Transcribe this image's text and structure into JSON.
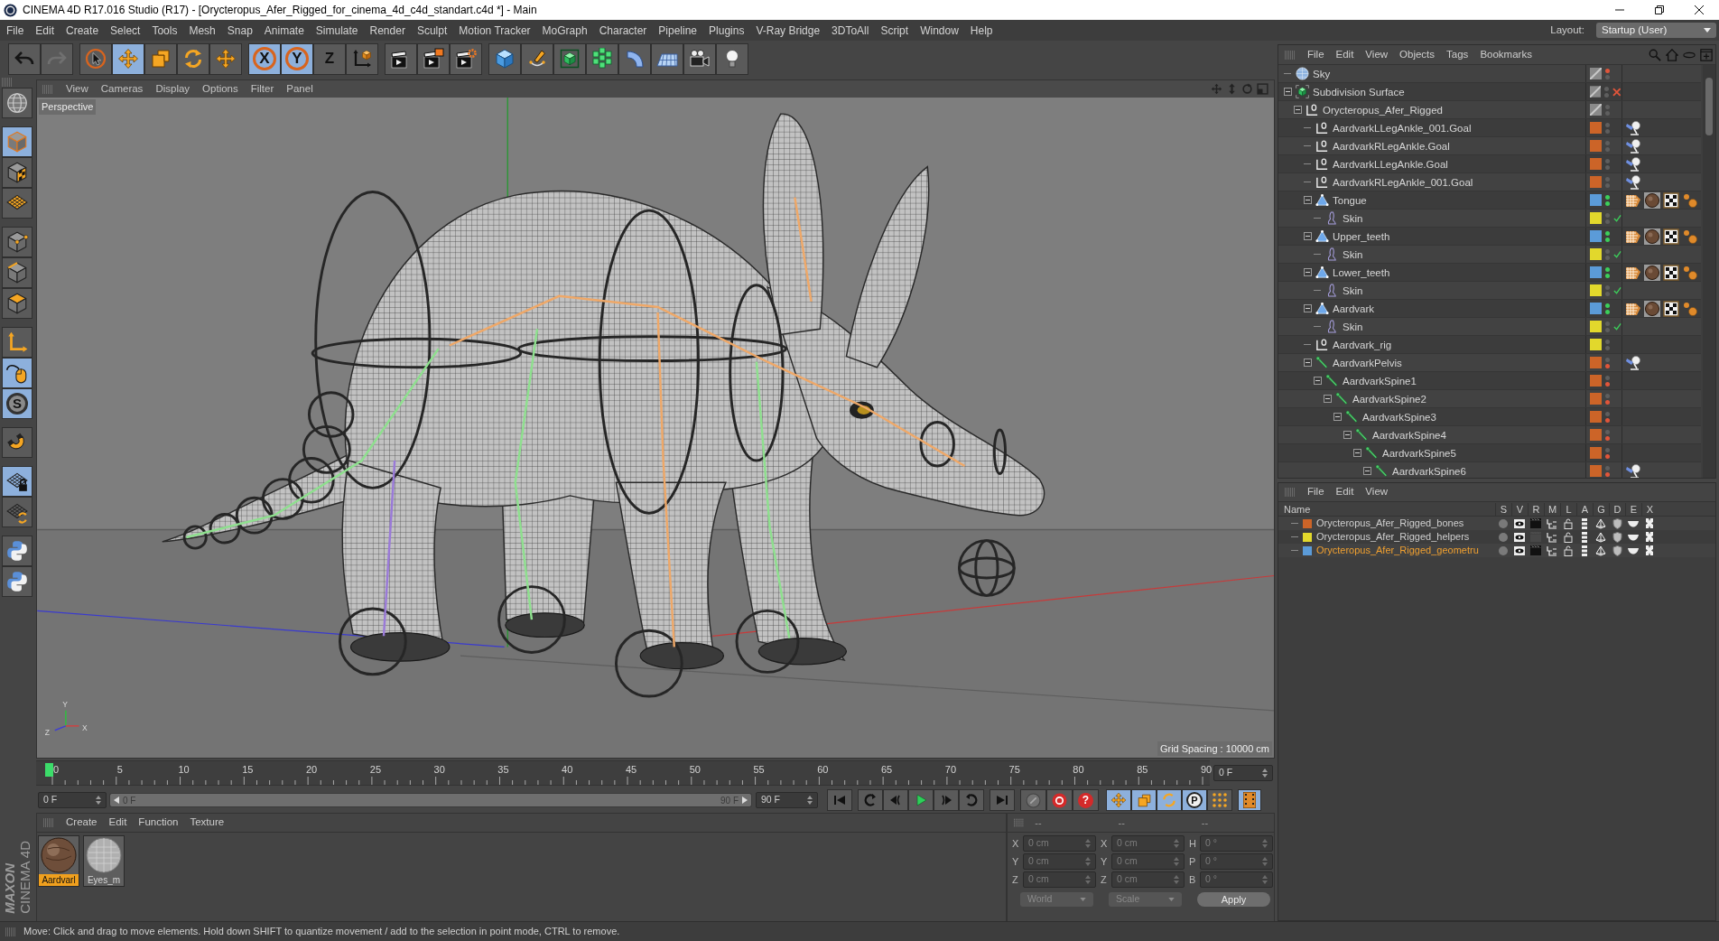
{
  "window": {
    "title": "CINEMA 4D R17.016 Studio (R17) - [Orycteropus_Afer_Rigged_for_cinema_4d_c4d_standart.c4d *] - Main"
  },
  "menu_bar": {
    "items": [
      "File",
      "Edit",
      "Create",
      "Select",
      "Tools",
      "Mesh",
      "Snap",
      "Animate",
      "Simulate",
      "Render",
      "Sculpt",
      "Motion Tracker",
      "MoGraph",
      "Character",
      "Pipeline",
      "Plugins",
      "V-Ray Bridge",
      "3DToAll",
      "Script",
      "Window",
      "Help"
    ],
    "layout_label": "Layout:",
    "layout_value": "Startup (User)"
  },
  "toolbar": {
    "groups": [
      [
        {
          "kind": "undo",
          "selected": false,
          "disabled": false
        },
        {
          "kind": "redo",
          "selected": false,
          "disabled": true
        }
      ],
      [
        {
          "kind": "select",
          "selected": false
        },
        {
          "kind": "move",
          "selected": true
        },
        {
          "kind": "scale",
          "selected": false
        },
        {
          "kind": "rotate",
          "selected": false
        },
        {
          "kind": "recent",
          "selected": false
        }
      ],
      [
        {
          "kind": "axis",
          "label": "X",
          "selected": true
        },
        {
          "kind": "axis",
          "label": "Y",
          "selected": true
        },
        {
          "kind": "axis",
          "label": "Z",
          "selected": false
        },
        {
          "kind": "coords",
          "selected": false
        }
      ],
      [
        {
          "kind": "render_view",
          "selected": false
        },
        {
          "kind": "render_picture",
          "selected": false
        },
        {
          "kind": "render_settings",
          "selected": false
        }
      ],
      [
        {
          "kind": "cube",
          "selected": false
        },
        {
          "kind": "pen",
          "selected": false
        },
        {
          "kind": "subdivision",
          "selected": false
        },
        {
          "kind": "cloner",
          "selected": false
        },
        {
          "kind": "deformer",
          "selected": false
        },
        {
          "kind": "floor",
          "selected": false
        },
        {
          "kind": "camera",
          "selected": false
        },
        {
          "kind": "light",
          "selected": false
        }
      ]
    ]
  },
  "side_toolbar": {
    "groups": [
      [
        {
          "kind": "globe",
          "selected": false
        }
      ],
      [
        {
          "kind": "model",
          "selected": true
        },
        {
          "kind": "texture",
          "selected": false
        },
        {
          "kind": "workplane",
          "selected": false
        }
      ],
      [
        {
          "kind": "points",
          "selected": false
        },
        {
          "kind": "edges",
          "selected": false
        },
        {
          "kind": "polygons",
          "selected": false
        }
      ],
      [
        {
          "kind": "axis_mode",
          "selected": false
        },
        {
          "kind": "tweak",
          "selected": true
        },
        {
          "kind": "soft_selection",
          "label": "S",
          "selected": true
        }
      ],
      [
        {
          "kind": "snap",
          "selected": false
        }
      ],
      [
        {
          "kind": "workplane_lock",
          "selected": true
        },
        {
          "kind": "workplane_align",
          "selected": false
        }
      ],
      [
        {
          "kind": "python",
          "selected": false
        },
        {
          "kind": "python",
          "selected": false
        }
      ]
    ]
  },
  "logo": {
    "brand": "MAXON",
    "product": "CINEMA 4D"
  },
  "viewport": {
    "menu": [
      "View",
      "Cameras",
      "Display",
      "Options",
      "Filter",
      "Panel"
    ],
    "camera": "Perspective",
    "grid_spacing": "Grid Spacing : 10000 cm",
    "axis_labels": [
      "Y",
      "Z",
      "X"
    ]
  },
  "timeline": {
    "ticks": [
      "0",
      "5",
      "10",
      "15",
      "20",
      "25",
      "30",
      "35",
      "40",
      "45",
      "50",
      "55",
      "60",
      "65",
      "70",
      "75",
      "80",
      "85",
      "90"
    ],
    "playhead": {
      "level": 0
    },
    "current_frame": "0 F",
    "start_frame": "0 F",
    "range": {
      "start": "0 F",
      "end": "90 F",
      "level": 1
    },
    "end_frame": "90 F"
  },
  "record_tools": [
    {
      "kind": "record"
    },
    {
      "kind": "autokey"
    },
    {
      "kind": "keyframe_selection",
      "label": "?"
    }
  ],
  "key_tools": [
    {
      "kind": "position",
      "selected": true
    },
    {
      "kind": "scale",
      "selected": true
    },
    {
      "kind": "rotation",
      "selected": true
    },
    {
      "kind": "parameter",
      "label": "P",
      "selected": true
    },
    {
      "kind": "point_level",
      "selected": false
    }
  ],
  "timeline_toggle": {
    "selected": true
  },
  "materials": {
    "menu": [
      "Create",
      "Edit",
      "Function",
      "Texture"
    ],
    "items": [
      {
        "name": "Aardvarl",
        "kind": "textured",
        "selected": true
      },
      {
        "name": "Eyes_m",
        "kind": "glass",
        "selected": false
      }
    ]
  },
  "coordinates": {
    "headers": [
      "--",
      "--",
      "--"
    ],
    "rows": [
      [
        {
          "axis": "X",
          "value": "0 cm"
        },
        {
          "axis": "X",
          "value": "0 cm"
        },
        {
          "axis": "H",
          "value": "0 °"
        }
      ],
      [
        {
          "axis": "Y",
          "value": "0 cm"
        },
        {
          "axis": "Y",
          "value": "0 cm"
        },
        {
          "axis": "P",
          "value": "0 °"
        }
      ],
      [
        {
          "axis": "Z",
          "value": "0 cm"
        },
        {
          "axis": "Z",
          "value": "0 cm"
        },
        {
          "axis": "B",
          "value": "0 °"
        }
      ]
    ],
    "dropdowns": [
      "World",
      "Scale"
    ],
    "apply": "Apply"
  },
  "object_manager": {
    "menu": [
      "File",
      "Edit",
      "View",
      "Objects",
      "Tags",
      "Bookmarks"
    ],
    "objects": [
      {
        "name": "Sky",
        "kind": "sky",
        "editor_dot": {
          "color": "#e0553a"
        },
        "render_dot": {
          "color": "#5e5e5e"
        }
      },
      {
        "name": "Subdivision Surface",
        "kind": "subdivision",
        "editor_dot": {
          "color": "#5e5e5e"
        },
        "render_dot": {
          "color": "#5e5e5e"
        },
        "enabled": false,
        "expanded": true,
        "children": [
          {
            "name": "Orycteropus_Afer_Rigged",
            "kind": "null",
            "editor_dot": {
              "color": "#5e5e5e"
            },
            "render_dot": {
              "color": "#5e5e5e"
            },
            "expanded": true,
            "children": [
              {
                "name": "AardvarkLLegAnkle_001.Goal",
                "kind": "null",
                "color": "#cc6428",
                "editor_dot": {
                  "color": "#5e5e5e"
                },
                "render_dot": {
                  "color": "#5e5e5e"
                },
                "tags": [
                  {
                    "kind": "ik"
                  }
                ]
              },
              {
                "name": "AardvarkRLegAnkle.Goal",
                "kind": "null",
                "color": "#cc6428",
                "editor_dot": {
                  "color": "#5e5e5e"
                },
                "render_dot": {
                  "color": "#5e5e5e"
                },
                "tags": [
                  {
                    "kind": "ik"
                  }
                ]
              },
              {
                "name": "AardvarkLLegAnkle.Goal",
                "kind": "null",
                "color": "#cc6428",
                "editor_dot": {
                  "color": "#5e5e5e"
                },
                "render_dot": {
                  "color": "#5e5e5e"
                },
                "tags": [
                  {
                    "kind": "ik"
                  }
                ]
              },
              {
                "name": "AardvarkRLegAnkle_001.Goal",
                "kind": "null",
                "color": "#cc6428",
                "editor_dot": {
                  "color": "#5e5e5e"
                },
                "render_dot": {
                  "color": "#5e5e5e"
                },
                "tags": [
                  {
                    "kind": "ik"
                  }
                ]
              },
              {
                "name": "Tongue",
                "kind": "polygon",
                "color": "#5b9bd8",
                "editor_dot": {
                  "color": "#3ccf5a"
                },
                "render_dot": {
                  "color": "#3ccf5a"
                },
                "tags": [
                  {
                    "kind": "weight"
                  },
                  {
                    "kind": "material"
                  },
                  {
                    "kind": "uvw"
                  },
                  {
                    "kind": "selection"
                  }
                ],
                "expanded": true,
                "children": [
                  {
                    "name": "Skin",
                    "kind": "skin",
                    "color": "#e2d82c",
                    "editor_dot": {
                      "color": "#5e5e5e"
                    },
                    "render_dot": {
                      "color": "#5e5e5e"
                    },
                    "enabled": true
                  }
                ]
              },
              {
                "name": "Upper_teeth",
                "kind": "polygon",
                "color": "#5b9bd8",
                "editor_dot": {
                  "color": "#3ccf5a"
                },
                "render_dot": {
                  "color": "#3ccf5a"
                },
                "tags": [
                  {
                    "kind": "weight"
                  },
                  {
                    "kind": "material"
                  },
                  {
                    "kind": "uvw"
                  },
                  {
                    "kind": "selection"
                  }
                ],
                "expanded": true,
                "children": [
                  {
                    "name": "Skin",
                    "kind": "skin",
                    "color": "#e2d82c",
                    "editor_dot": {
                      "color": "#5e5e5e"
                    },
                    "render_dot": {
                      "color": "#5e5e5e"
                    },
                    "enabled": true
                  }
                ]
              },
              {
                "name": "Lower_teeth",
                "kind": "polygon",
                "color": "#5b9bd8",
                "editor_dot": {
                  "color": "#3ccf5a"
                },
                "render_dot": {
                  "color": "#3ccf5a"
                },
                "tags": [
                  {
                    "kind": "weight"
                  },
                  {
                    "kind": "material"
                  },
                  {
                    "kind": "uvw"
                  },
                  {
                    "kind": "selection"
                  }
                ],
                "expanded": true,
                "children": [
                  {
                    "name": "Skin",
                    "kind": "skin",
                    "color": "#e2d82c",
                    "editor_dot": {
                      "color": "#5e5e5e"
                    },
                    "render_dot": {
                      "color": "#5e5e5e"
                    },
                    "enabled": true
                  }
                ]
              },
              {
                "name": "Aardvark",
                "kind": "polygon",
                "color": "#5b9bd8",
                "editor_dot": {
                  "color": "#3ccf5a"
                },
                "render_dot": {
                  "color": "#3ccf5a"
                },
                "tags": [
                  {
                    "kind": "weight"
                  },
                  {
                    "kind": "material"
                  },
                  {
                    "kind": "uvw"
                  },
                  {
                    "kind": "selection"
                  }
                ],
                "expanded": true,
                "children": [
                  {
                    "name": "Skin",
                    "kind": "skin",
                    "color": "#e2d82c",
                    "editor_dot": {
                      "color": "#5e5e5e"
                    },
                    "render_dot": {
                      "color": "#5e5e5e"
                    },
                    "enabled": true
                  }
                ]
              },
              {
                "name": "Aardvark_rig",
                "kind": "null",
                "color": "#e2d82c",
                "editor_dot": {
                  "color": "#5e5e5e"
                },
                "render_dot": {
                  "color": "#5e5e5e"
                }
              },
              {
                "name": "AardvarkPelvis",
                "kind": "joint",
                "color": "#cc6428",
                "editor_dot": {
                  "color": "#5e5e5e"
                },
                "render_dot": {
                  "color": "#e0553a"
                },
                "tags": [
                  {
                    "kind": "ik"
                  }
                ],
                "expanded": true,
                "children": [
                  {
                    "name": "AardvarkSpine1",
                    "kind": "joint",
                    "color": "#cc6428",
                    "editor_dot": {
                      "color": "#5e5e5e"
                    },
                    "render_dot": {
                      "color": "#e0553a"
                    },
                    "expanded": true,
                    "children": [
                      {
                        "name": "AardvarkSpine2",
                        "kind": "joint",
                        "color": "#cc6428",
                        "editor_dot": {
                          "color": "#5e5e5e"
                        },
                        "render_dot": {
                          "color": "#e0553a"
                        },
                        "expanded": true,
                        "children": [
                          {
                            "name": "AardvarkSpine3",
                            "kind": "joint",
                            "color": "#cc6428",
                            "editor_dot": {
                              "color": "#5e5e5e"
                            },
                            "render_dot": {
                              "color": "#e0553a"
                            },
                            "expanded": true,
                            "children": [
                              {
                                "name": "AardvarkSpine4",
                                "kind": "joint",
                                "color": "#cc6428",
                                "editor_dot": {
                                  "color": "#5e5e5e"
                                },
                                "render_dot": {
                                  "color": "#e0553a"
                                },
                                "expanded": true,
                                "children": [
                                  {
                                    "name": "AardvarkSpine5",
                                    "kind": "joint",
                                    "color": "#cc6428",
                                    "editor_dot": {
                                      "color": "#5e5e5e"
                                    },
                                    "render_dot": {
                                      "color": "#e0553a"
                                    },
                                    "expanded": true,
                                    "children": [
                                      {
                                        "name": "AardvarkSpine6",
                                        "kind": "joint",
                                        "color": "#cc6428",
                                        "editor_dot": {
                                          "color": "#5e5e5e"
                                        },
                                        "render_dot": {
                                          "color": "#e0553a"
                                        },
                                        "tags": [
                                          {
                                            "kind": "ik"
                                          }
                                        ],
                                        "expanded": true
                                      }
                                    ]
                                  }
                                ]
                              }
                            ]
                          }
                        ]
                      }
                    ]
                  }
                ]
              }
            ]
          }
        ]
      }
    ]
  },
  "layer_manager": {
    "menu": [
      "File",
      "Edit",
      "View"
    ],
    "columns": [
      "Name",
      "S",
      "V",
      "R",
      "M",
      "L",
      "A",
      "G",
      "D",
      "E",
      "X"
    ],
    "layers": [
      {
        "name": "Orycteropus_Afer_Rigged_bones",
        "color": "#cc6428",
        "selected": false,
        "render": true
      },
      {
        "name": "Orycteropus_Afer_Rigged_helpers",
        "color": "#e2d82c",
        "selected": false,
        "render": false
      },
      {
        "name": "Orycteropus_Afer_Rigged_geometru",
        "color": "#5b9bd8",
        "selected": true,
        "render": true
      }
    ]
  },
  "status_bar": {
    "text": "Move: Click and drag to move elements. Hold down SHIFT to quantize movement / add to the selection in point mode, CTRL to remove."
  }
}
